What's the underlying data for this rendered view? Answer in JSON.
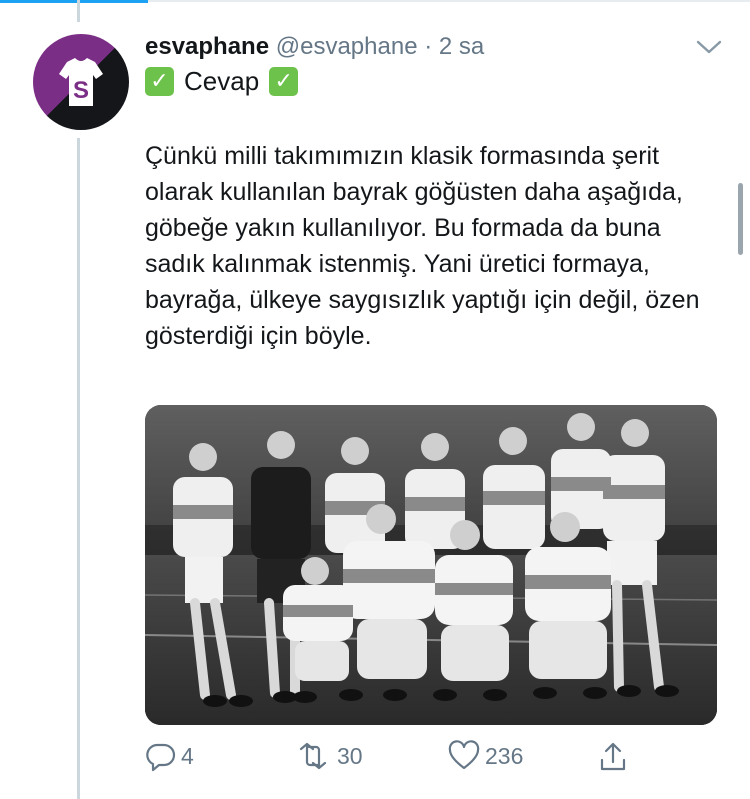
{
  "tweet": {
    "display_name": "esvaphane",
    "handle": "@esvaphane",
    "separator": "·",
    "time": "2 sa",
    "subtitle": "Cevap",
    "text": "Çünkü milli takımımızın klasik formasında şerit olarak kullanılan bayrak göğüsten daha aşağıda, göbeğe yakın kullanılıyor. Bu formada da buna sadık kalınmak istenmiş. Yani üretici formaya, bayrağa, ülkeye saygısızlık yaptığı için değil, özen gösterdiği için böyle.",
    "avatar_letter": "S",
    "emoji": "✓"
  },
  "actions": {
    "replies": "4",
    "retweets": "30",
    "likes": "236"
  },
  "colors": {
    "accent": "#1da1f2",
    "secondary_text": "#657786",
    "avatar_purple": "#7b2e86",
    "check_green": "#6cc24a"
  },
  "icons": {
    "reply": "reply-icon",
    "retweet": "retweet-icon",
    "like": "heart-icon",
    "share": "share-icon",
    "menu": "chevron-down-icon"
  }
}
